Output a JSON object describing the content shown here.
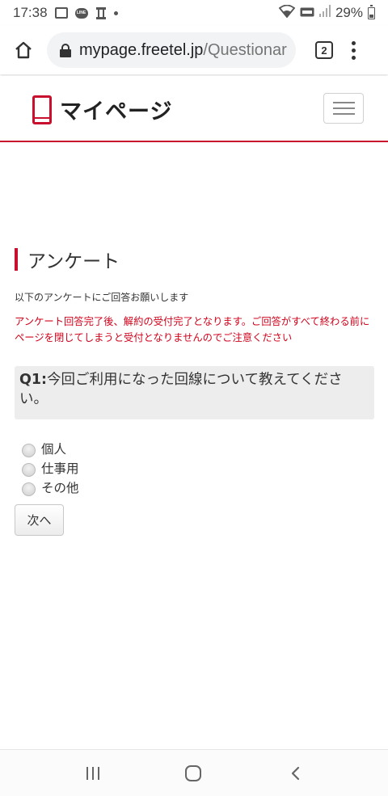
{
  "status_bar": {
    "time": "17:38",
    "battery": "29%",
    "icons": [
      "image-icon",
      "line-app-icon",
      "tower-icon",
      "dot-icon",
      "wifi-icon",
      "volte-icon",
      "signal-icon",
      "battery-icon"
    ]
  },
  "browser": {
    "url_host": "mypage.freetel.jp",
    "url_path": "/Questionar",
    "tab_count": "2"
  },
  "header": {
    "logo_text": "マイページ",
    "accent_color": "#c8102e"
  },
  "page": {
    "title": "アンケート",
    "intro": "以下のアンケートにご回答お願いします",
    "warning": "アンケート回答完了後、解約の受付完了となります。ご回答がすべて終わる前にページを閉じてしまうと受付となりませんのでご注意ください",
    "warning_color": "#d0021b",
    "question": {
      "number": "Q1:",
      "text": "今回ご利用になった回線について教えてください。"
    },
    "options": [
      "個人",
      "仕事用",
      "その他"
    ],
    "next_label": "次へ"
  }
}
